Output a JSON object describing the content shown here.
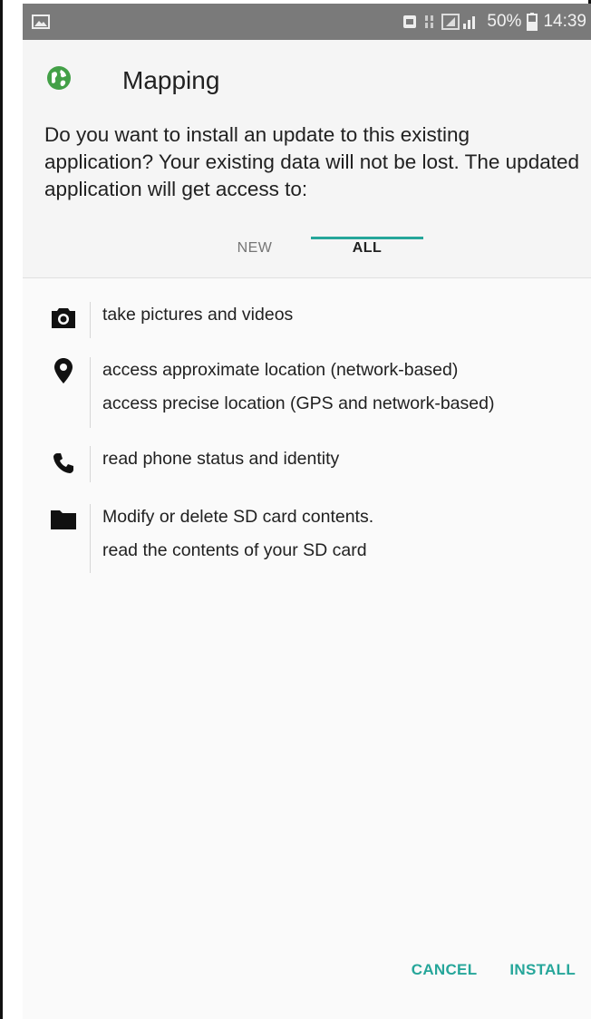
{
  "status_bar": {
    "battery": "50%",
    "time": "14:39",
    "icons": [
      "image-icon",
      "sim-icon",
      "vibrate-icon",
      "signal-icon",
      "battery-icon"
    ]
  },
  "app": {
    "name": "Mapping",
    "icon": "globe-icon",
    "icon_color": "#43a047"
  },
  "prompt": "Do you want to install an update to this existing application? Your existing data will not be lost. The updated application will get access to:",
  "tabs": [
    {
      "label": "NEW",
      "selected": false
    },
    {
      "label": "ALL",
      "selected": true
    }
  ],
  "permissions": [
    {
      "icon": "camera-icon",
      "lines": [
        "take pictures and videos"
      ]
    },
    {
      "icon": "location-pin-icon",
      "lines": [
        "access approximate location (network-based)",
        "access precise location (GPS and network-based)"
      ]
    },
    {
      "icon": "phone-icon",
      "lines": [
        "read phone status and identity"
      ]
    },
    {
      "icon": "folder-icon",
      "lines": [
        "Modify or delete SD card contents.",
        "read the contents of your SD card"
      ]
    }
  ],
  "actions": {
    "cancel_label": "CANCEL",
    "install_label": "INSTALL"
  },
  "colors": {
    "accent": "#26a69a",
    "status_bar": "#7a7a7a"
  }
}
